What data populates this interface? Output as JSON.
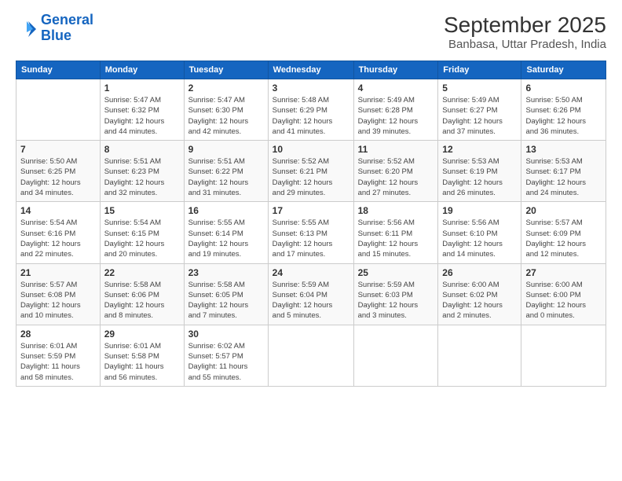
{
  "logo": {
    "line1": "General",
    "line2": "Blue"
  },
  "title": "September 2025",
  "subtitle": "Banbasa, Uttar Pradesh, India",
  "weekdays": [
    "Sunday",
    "Monday",
    "Tuesday",
    "Wednesday",
    "Thursday",
    "Friday",
    "Saturday"
  ],
  "weeks": [
    [
      {
        "day": "",
        "info": ""
      },
      {
        "day": "1",
        "info": "Sunrise: 5:47 AM\nSunset: 6:32 PM\nDaylight: 12 hours\nand 44 minutes."
      },
      {
        "day": "2",
        "info": "Sunrise: 5:47 AM\nSunset: 6:30 PM\nDaylight: 12 hours\nand 42 minutes."
      },
      {
        "day": "3",
        "info": "Sunrise: 5:48 AM\nSunset: 6:29 PM\nDaylight: 12 hours\nand 41 minutes."
      },
      {
        "day": "4",
        "info": "Sunrise: 5:49 AM\nSunset: 6:28 PM\nDaylight: 12 hours\nand 39 minutes."
      },
      {
        "day": "5",
        "info": "Sunrise: 5:49 AM\nSunset: 6:27 PM\nDaylight: 12 hours\nand 37 minutes."
      },
      {
        "day": "6",
        "info": "Sunrise: 5:50 AM\nSunset: 6:26 PM\nDaylight: 12 hours\nand 36 minutes."
      }
    ],
    [
      {
        "day": "7",
        "info": "Sunrise: 5:50 AM\nSunset: 6:25 PM\nDaylight: 12 hours\nand 34 minutes."
      },
      {
        "day": "8",
        "info": "Sunrise: 5:51 AM\nSunset: 6:23 PM\nDaylight: 12 hours\nand 32 minutes."
      },
      {
        "day": "9",
        "info": "Sunrise: 5:51 AM\nSunset: 6:22 PM\nDaylight: 12 hours\nand 31 minutes."
      },
      {
        "day": "10",
        "info": "Sunrise: 5:52 AM\nSunset: 6:21 PM\nDaylight: 12 hours\nand 29 minutes."
      },
      {
        "day": "11",
        "info": "Sunrise: 5:52 AM\nSunset: 6:20 PM\nDaylight: 12 hours\nand 27 minutes."
      },
      {
        "day": "12",
        "info": "Sunrise: 5:53 AM\nSunset: 6:19 PM\nDaylight: 12 hours\nand 26 minutes."
      },
      {
        "day": "13",
        "info": "Sunrise: 5:53 AM\nSunset: 6:17 PM\nDaylight: 12 hours\nand 24 minutes."
      }
    ],
    [
      {
        "day": "14",
        "info": "Sunrise: 5:54 AM\nSunset: 6:16 PM\nDaylight: 12 hours\nand 22 minutes."
      },
      {
        "day": "15",
        "info": "Sunrise: 5:54 AM\nSunset: 6:15 PM\nDaylight: 12 hours\nand 20 minutes."
      },
      {
        "day": "16",
        "info": "Sunrise: 5:55 AM\nSunset: 6:14 PM\nDaylight: 12 hours\nand 19 minutes."
      },
      {
        "day": "17",
        "info": "Sunrise: 5:55 AM\nSunset: 6:13 PM\nDaylight: 12 hours\nand 17 minutes."
      },
      {
        "day": "18",
        "info": "Sunrise: 5:56 AM\nSunset: 6:11 PM\nDaylight: 12 hours\nand 15 minutes."
      },
      {
        "day": "19",
        "info": "Sunrise: 5:56 AM\nSunset: 6:10 PM\nDaylight: 12 hours\nand 14 minutes."
      },
      {
        "day": "20",
        "info": "Sunrise: 5:57 AM\nSunset: 6:09 PM\nDaylight: 12 hours\nand 12 minutes."
      }
    ],
    [
      {
        "day": "21",
        "info": "Sunrise: 5:57 AM\nSunset: 6:08 PM\nDaylight: 12 hours\nand 10 minutes."
      },
      {
        "day": "22",
        "info": "Sunrise: 5:58 AM\nSunset: 6:06 PM\nDaylight: 12 hours\nand 8 minutes."
      },
      {
        "day": "23",
        "info": "Sunrise: 5:58 AM\nSunset: 6:05 PM\nDaylight: 12 hours\nand 7 minutes."
      },
      {
        "day": "24",
        "info": "Sunrise: 5:59 AM\nSunset: 6:04 PM\nDaylight: 12 hours\nand 5 minutes."
      },
      {
        "day": "25",
        "info": "Sunrise: 5:59 AM\nSunset: 6:03 PM\nDaylight: 12 hours\nand 3 minutes."
      },
      {
        "day": "26",
        "info": "Sunrise: 6:00 AM\nSunset: 6:02 PM\nDaylight: 12 hours\nand 2 minutes."
      },
      {
        "day": "27",
        "info": "Sunrise: 6:00 AM\nSunset: 6:00 PM\nDaylight: 12 hours\nand 0 minutes."
      }
    ],
    [
      {
        "day": "28",
        "info": "Sunrise: 6:01 AM\nSunset: 5:59 PM\nDaylight: 11 hours\nand 58 minutes."
      },
      {
        "day": "29",
        "info": "Sunrise: 6:01 AM\nSunset: 5:58 PM\nDaylight: 11 hours\nand 56 minutes."
      },
      {
        "day": "30",
        "info": "Sunrise: 6:02 AM\nSunset: 5:57 PM\nDaylight: 11 hours\nand 55 minutes."
      },
      {
        "day": "",
        "info": ""
      },
      {
        "day": "",
        "info": ""
      },
      {
        "day": "",
        "info": ""
      },
      {
        "day": "",
        "info": ""
      }
    ]
  ]
}
